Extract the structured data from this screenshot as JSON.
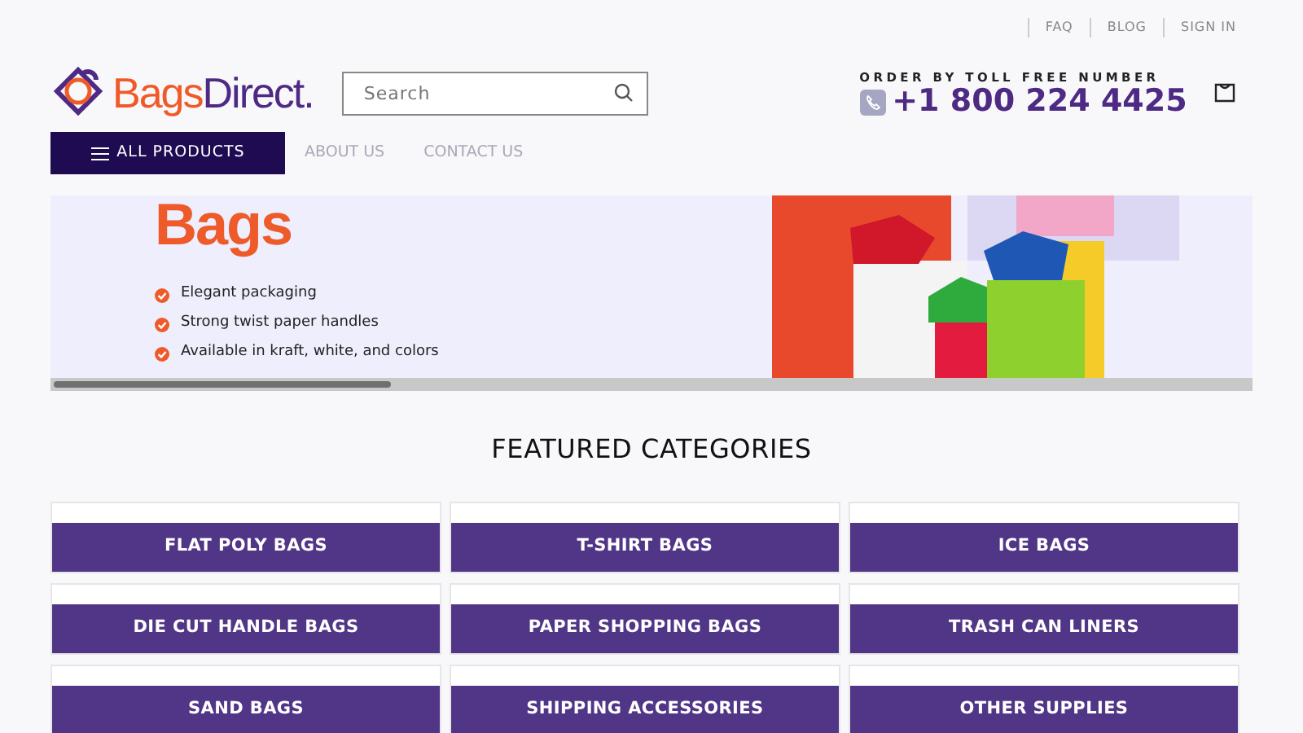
{
  "top_links": [
    "FAQ",
    "BLOG",
    "SIGN IN"
  ],
  "logo": {
    "brand": "Bags",
    "brand_rest": "Direct."
  },
  "search": {
    "placeholder": "Search"
  },
  "phone": {
    "caption": "ORDER BY TOLL FREE NUMBER",
    "number": "+1 800 224 4425"
  },
  "nav": [
    {
      "label": "ALL PRODUCTS",
      "kind": "menu"
    },
    {
      "label": "ABOUT US",
      "kind": "link"
    },
    {
      "label": "CONTACT US",
      "kind": "link"
    }
  ],
  "banner": {
    "heading": "Bags",
    "bullets": [
      "Elegant packaging",
      "Strong twist paper handles",
      "Available in kraft, white, and colors"
    ]
  },
  "featured": {
    "title": "FEATURED CATEGORIES",
    "categories": [
      {
        "label": "FLAT POLY BAGS"
      },
      {
        "label": "T-SHIRT BAGS"
      },
      {
        "label": "ICE BAGS"
      },
      {
        "label": "DIE CUT HANDLE BAGS"
      },
      {
        "label": "PAPER SHOPPING BAGS"
      },
      {
        "label": "TRASH CAN LINERS"
      },
      {
        "label": "SAND BAGS"
      },
      {
        "label": "SHIPPING ACCESSORIES"
      },
      {
        "label": "OTHER SUPPLIES"
      }
    ]
  }
}
